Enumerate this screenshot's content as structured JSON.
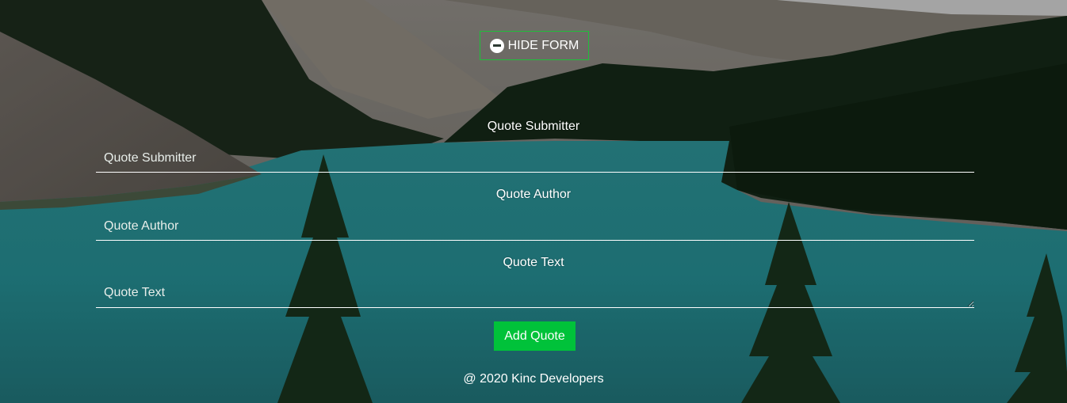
{
  "form_toggle": {
    "label": "HIDE FORM",
    "icon": "minus-circle-icon",
    "border_color": "#1fbf3a"
  },
  "form": {
    "submitter": {
      "label": "Quote Submitter",
      "placeholder": "Quote Submitter",
      "value": ""
    },
    "author": {
      "label": "Quote Author",
      "placeholder": "Quote Author",
      "value": ""
    },
    "text": {
      "label": "Quote Text",
      "placeholder": "Quote Text",
      "value": ""
    },
    "submit_label": "Add Quote",
    "submit_color": "#00c23a"
  },
  "footer": {
    "text": "@ 2020 Kinc Developers"
  }
}
